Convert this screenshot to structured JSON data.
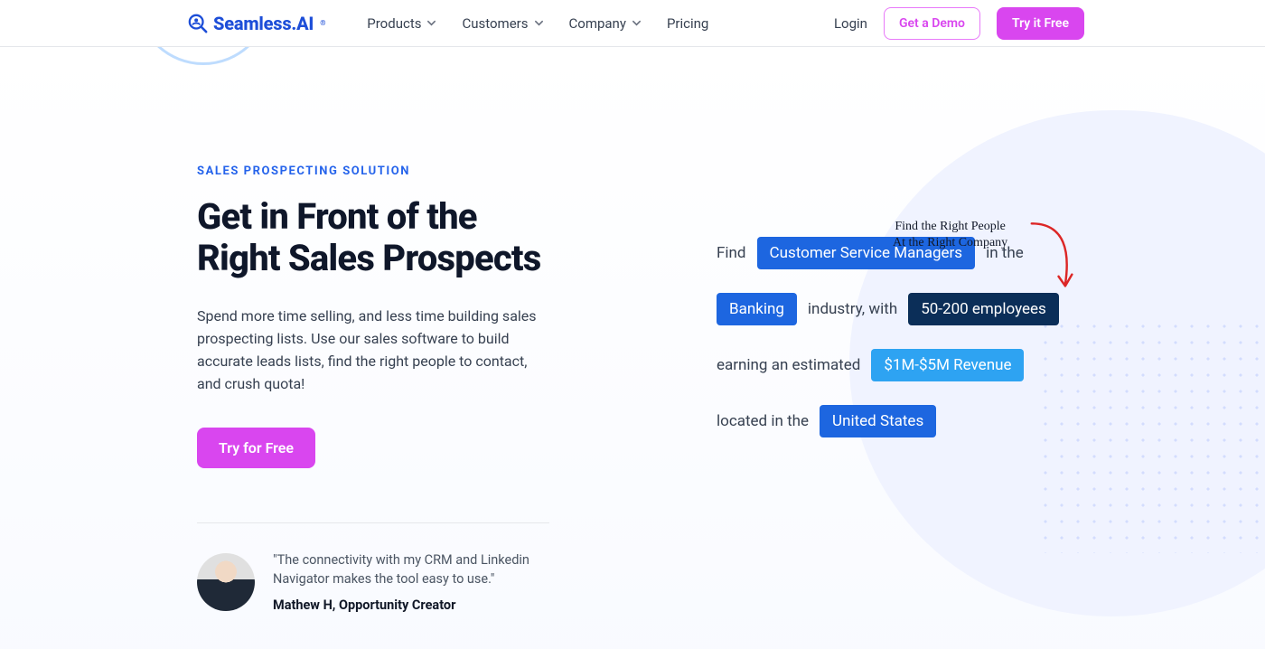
{
  "brand": {
    "name": "Seamless.AI"
  },
  "nav": {
    "items": [
      {
        "label": "Products",
        "has_chevron": true
      },
      {
        "label": "Customers",
        "has_chevron": true
      },
      {
        "label": "Company",
        "has_chevron": true
      },
      {
        "label": "Pricing",
        "has_chevron": false
      }
    ],
    "login_label": "Login",
    "demo_label": "Get a Demo",
    "try_label": "Try it Free"
  },
  "hero": {
    "eyebrow": "SALES PROSPECTING SOLUTION",
    "title_line1": "Get in Front of the",
    "title_line2": "Right Sales Prospects",
    "description": "Spend more time selling, and less time building sales prospecting lists. Use our sales software to build accurate leads lists, find the right people to contact, and crush quota!",
    "cta_label": "Try for Free"
  },
  "testimonial": {
    "quote": "\"The connectivity with my CRM and Linkedin Navigator makes the tool easy to use.\"",
    "author": "Mathew H, Opportunity Creator"
  },
  "script_note": {
    "line1": "Find the Right People",
    "line2": "At the Right Company"
  },
  "query": {
    "row1_pre": "Find",
    "row1_chip": "Customer Service Managers",
    "row1_post": "in the",
    "row2_chip": "Banking",
    "row2_mid": "industry, with",
    "row2_chip2": "50-200 employees",
    "row3_pre": "earning an estimated",
    "row3_chip": "$1M-$5M Revenue",
    "row4_pre": "located in the",
    "row4_chip": "United States"
  }
}
